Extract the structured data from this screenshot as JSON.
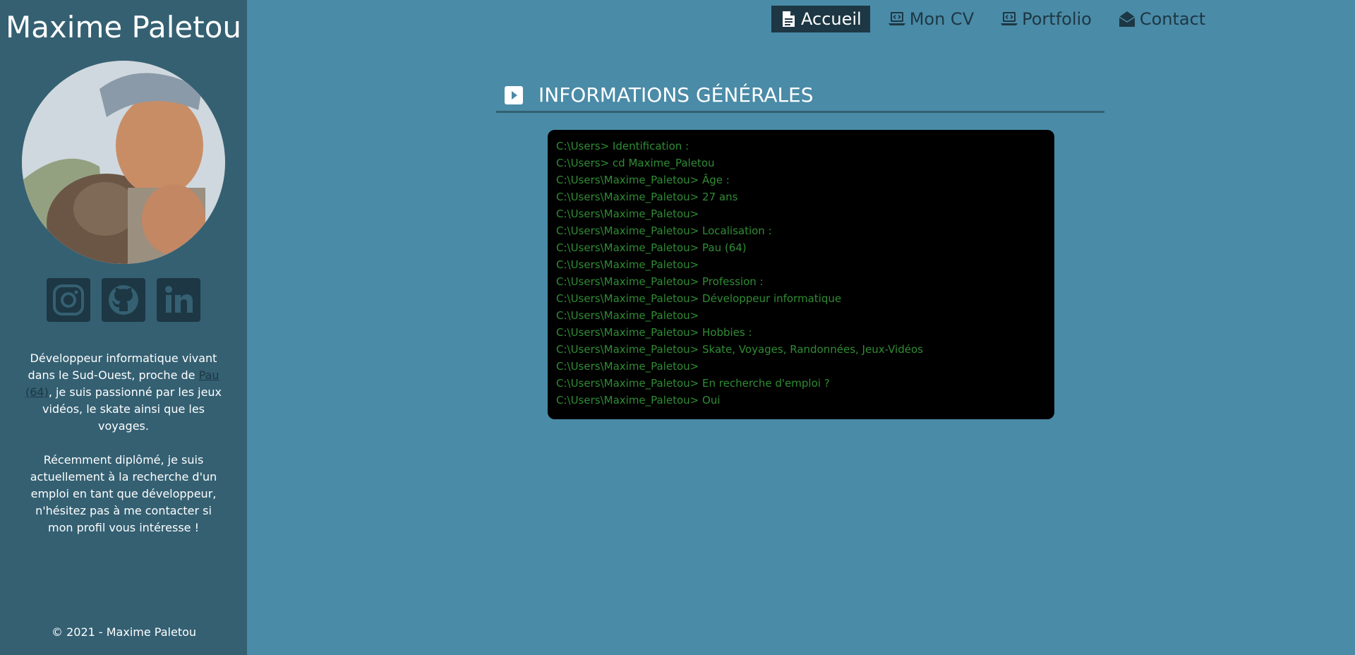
{
  "sidebar": {
    "name": "Maxime Paletou",
    "bio_part1_before_link": "Développeur informatique vivant dans le Sud-Ouest, proche de ",
    "bio_link": "Pau (64)",
    "bio_part1_after_link": ", je suis passionné par les jeux vidéos, le skate ainsi que les voyages.",
    "bio_part2": "Récemment diplômé, je suis actuellement à la recherche d'un emploi en tant que développeur, n'hésitez pas à me contacter si mon profil vous intéresse !",
    "copyright": "© 2021 - Maxime Paletou",
    "socials": [
      {
        "icon": "instagram-icon"
      },
      {
        "icon": "github-icon"
      },
      {
        "icon": "linkedin-icon"
      }
    ]
  },
  "nav": {
    "items": [
      {
        "label": "Accueil",
        "icon": "document-icon",
        "active": true
      },
      {
        "label": "Mon CV",
        "icon": "laptop-code-icon",
        "active": false
      },
      {
        "label": "Portfolio",
        "icon": "laptop-code-icon",
        "active": false
      },
      {
        "label": "Contact",
        "icon": "envelope-open-icon",
        "active": false
      }
    ]
  },
  "section": {
    "title": "INFORMATIONS GÉNÉRALES"
  },
  "terminal": {
    "lines": [
      "C:\\Users> Identification :",
      "C:\\Users> cd Maxime_Paletou",
      "C:\\Users\\Maxime_Paletou> Âge :",
      "C:\\Users\\Maxime_Paletou> 27 ans",
      "C:\\Users\\Maxime_Paletou>",
      "C:\\Users\\Maxime_Paletou> Localisation :",
      "C:\\Users\\Maxime_Paletou> Pau (64)",
      "C:\\Users\\Maxime_Paletou>",
      "C:\\Users\\Maxime_Paletou> Profession :",
      "C:\\Users\\Maxime_Paletou> Développeur informatique",
      "C:\\Users\\Maxime_Paletou>",
      "C:\\Users\\Maxime_Paletou> Hobbies :",
      "C:\\Users\\Maxime_Paletou> Skate, Voyages, Randonnées, Jeux-Vidéos",
      "C:\\Users\\Maxime_Paletou>",
      "C:\\Users\\Maxime_Paletou> En recherche d'emploi ?",
      "C:\\Users\\Maxime_Paletou> Oui"
    ]
  },
  "colors": {
    "page_bg": "#4a8ba7",
    "sidebar_bg": "#346072",
    "dark_accent": "#1d3744",
    "terminal_text": "#2f8c34"
  }
}
